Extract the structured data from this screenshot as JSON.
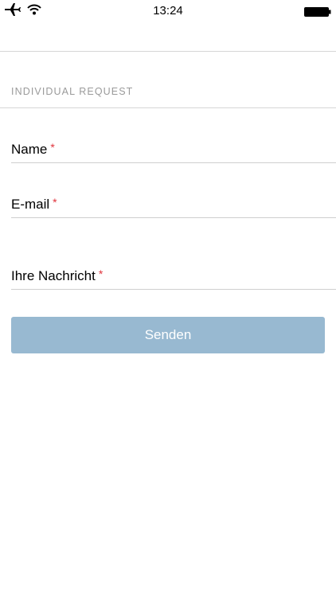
{
  "status_bar": {
    "time": "13:24",
    "icons": [
      "airplane-icon",
      "wifi-icon",
      "battery-icon"
    ]
  },
  "form": {
    "section_title": "INDIVIDUAL REQUEST",
    "required_marker": "*",
    "fields": [
      {
        "label": "Name",
        "value": "",
        "required": true
      },
      {
        "label": "E-mail",
        "value": "",
        "required": true
      },
      {
        "label": "Ihre Nachricht",
        "value": "",
        "required": true
      }
    ],
    "submit_label": "Senden"
  },
  "colors": {
    "button_background": "#98b9d1",
    "required_marker": "#e0333c",
    "section_title": "#9a9a9a",
    "divider": "#d6d6d6"
  }
}
